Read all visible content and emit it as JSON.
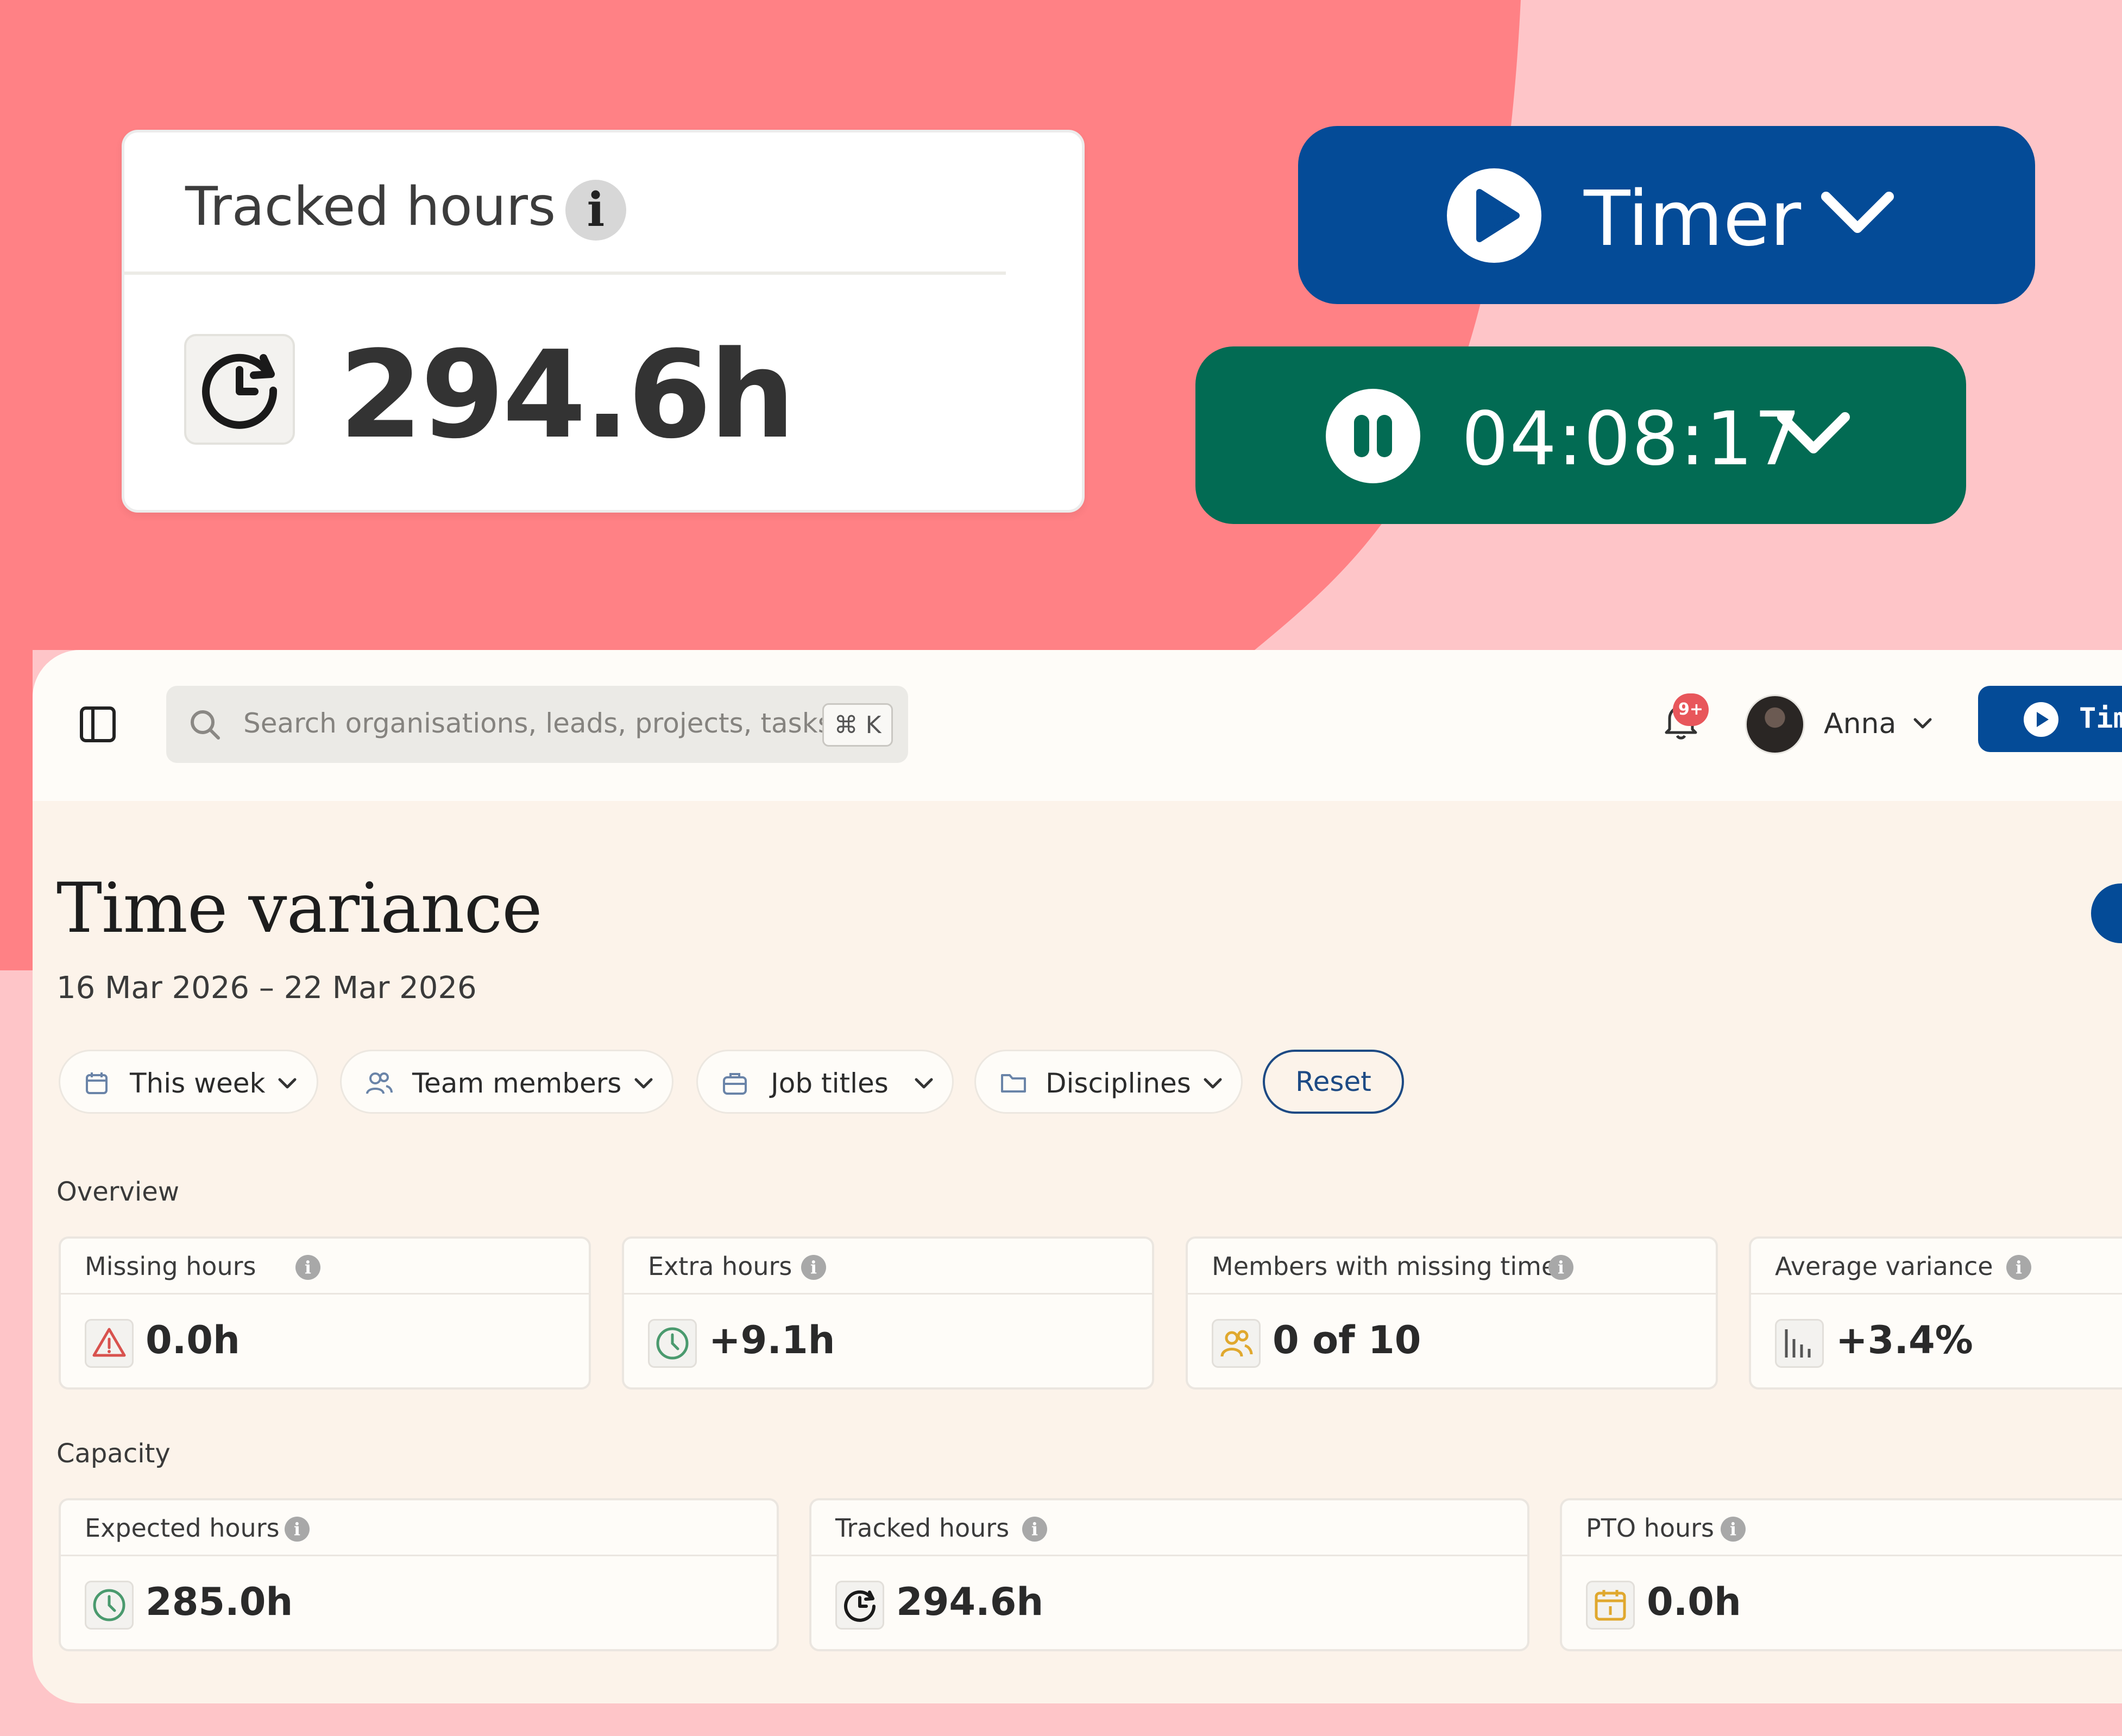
{
  "big_card": {
    "title": "Tracked hours",
    "info": "i",
    "value": "294.6h"
  },
  "timer_button": {
    "label": "Timer"
  },
  "running_timer": {
    "elapsed": "04:08:17"
  },
  "topbar": {
    "search_placeholder": "Search organisations, leads, projects, tasks...",
    "search_shortcut": "⌘ K",
    "notifications_badge": "9+",
    "user_name": "Anna",
    "timer_label": "Tim"
  },
  "page": {
    "title": "Time variance",
    "date_range": "16 Mar 2026 – 22 Mar 2026"
  },
  "filters": {
    "period": "This week",
    "team_members": "Team members",
    "job_titles": "Job titles",
    "disciplines": "Disciplines",
    "reset": "Reset"
  },
  "overview": {
    "label": "Overview",
    "cards": [
      {
        "title": "Missing hours",
        "value": "0.0h",
        "icon": "warning-icon"
      },
      {
        "title": "Extra hours",
        "value": "+9.1h",
        "icon": "clock-icon"
      },
      {
        "title": "Members with missing time",
        "value": "0 of 10",
        "icon": "people-icon"
      },
      {
        "title": "Average variance",
        "value": "+3.4%",
        "icon": "bar-chart-icon"
      }
    ]
  },
  "capacity": {
    "label": "Capacity",
    "cards": [
      {
        "title": "Expected hours",
        "value": "285.0h",
        "icon": "clock-icon"
      },
      {
        "title": "Tracked hours",
        "value": "294.6h",
        "icon": "history-clock-icon"
      },
      {
        "title": "PTO hours",
        "value": "0.0h",
        "icon": "calendar-icon"
      }
    ]
  },
  "colors": {
    "primary_blue": "#044b97",
    "running_green": "#026b53",
    "coral": "#ff8185",
    "pink": "#fec5c8"
  }
}
